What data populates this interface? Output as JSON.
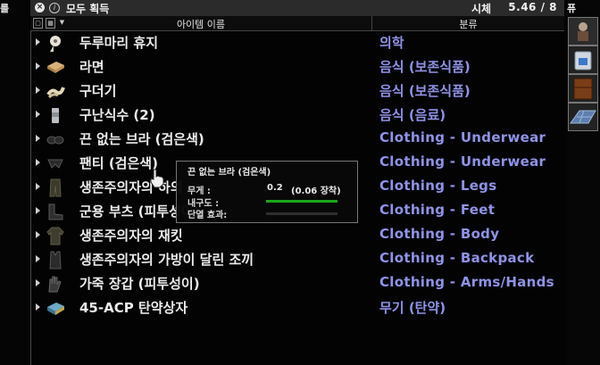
{
  "window": {
    "title": "모두 획득",
    "container_label": "시체",
    "weight_text": "5.46 / 8",
    "left_tag": "를",
    "right_tag": "퓨"
  },
  "columns": {
    "name": "아이템 이름",
    "category": "분류"
  },
  "items": [
    {
      "name": "두루마리 휴지",
      "category": "의학",
      "icon": "toilet-paper-icon"
    },
    {
      "name": "라면",
      "category": "음식 (보존식품)",
      "icon": "ramen-icon"
    },
    {
      "name": "구더기",
      "category": "음식 (보존식품)",
      "icon": "maggot-icon"
    },
    {
      "name": "구난식수 (2)",
      "category": "음식 (음료)",
      "icon": "water-bottle-icon"
    },
    {
      "name": "끈 없는 브라 (검은색)",
      "category": "Clothing - Underwear",
      "icon": "bra-icon"
    },
    {
      "name": "팬티 (검은색)",
      "category": "Clothing - Underwear",
      "icon": "underwear-icon"
    },
    {
      "name": "생존주의자의 하의",
      "category": "Clothing - Legs",
      "icon": "pants-icon"
    },
    {
      "name": "군용 부츠 (피투성이)",
      "category": "Clothing - Feet",
      "icon": "boots-icon"
    },
    {
      "name": "생존주의자의 재킷",
      "category": "Clothing - Body",
      "icon": "jacket-icon"
    },
    {
      "name": "생존주의자의 가방이 달린 조끼",
      "category": "Clothing - Backpack",
      "icon": "vest-icon"
    },
    {
      "name": "가죽 장갑 (피투성이)",
      "category": "Clothing - Arms/Hands",
      "icon": "gloves-icon"
    },
    {
      "name": "45-ACP 탄약상자",
      "category": "무기 (탄약)",
      "icon": "ammo-box-icon"
    }
  ],
  "tooltip": {
    "title": "끈 없는 브라 (검은색)",
    "weight_label": "무게 :",
    "weight_value": "0.2",
    "weight_equipped": "(0.06 장착)",
    "condition_label": "내구도 :",
    "condition_fraction": 1.0,
    "insulation_label": "단열 효과:",
    "insulation_fraction": 0.0
  },
  "colors": {
    "category_text": "#8f93e6",
    "condition_bar": "#1aa81a"
  },
  "sidebar_buttons": [
    "corpse-container-icon",
    "backpack-icon",
    "crate-icon",
    "floor-icon"
  ]
}
